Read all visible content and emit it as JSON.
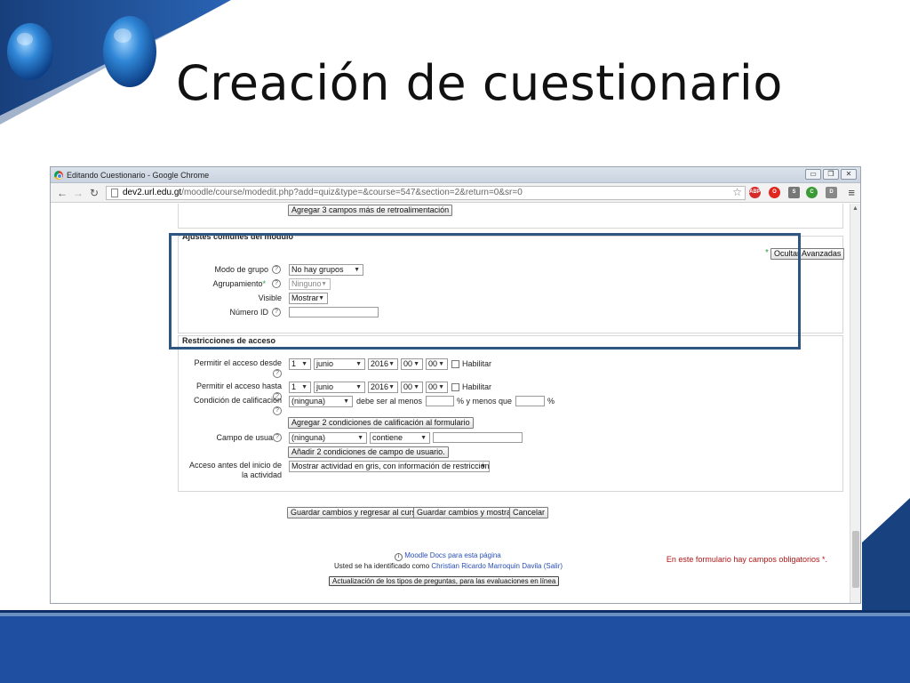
{
  "slide": {
    "title": "Creación de cuestionario"
  },
  "browser": {
    "window_title": "Editando Cuestionario - Google Chrome",
    "url_host": "dev2.url.edu.gt",
    "url_path": "/moodle/course/modedit.php?add=quiz&type=&course=547&section=2&return=0&sr=0",
    "extensions": [
      "ABP",
      "O",
      "S",
      "C",
      "D"
    ]
  },
  "form": {
    "feedback_button": "Agregar 3 campos más de retroalimentación",
    "common_section": {
      "legend": "Ajustes comunes del módulo",
      "advanced_button": "Ocultar Avanzadas",
      "group_mode_label": "Modo de grupo",
      "group_mode_value": "No hay grupos",
      "grouping_label": "Agrupamiento",
      "grouping_value": "Ninguno",
      "visible_label": "Visible",
      "visible_value": "Mostrar",
      "idnumber_label": "Número ID",
      "idnumber_value": ""
    },
    "restrictions": {
      "legend": "Restricciones de acceso",
      "from_label": "Permitir el acceso desde",
      "from_day": "1",
      "from_month": "junio",
      "from_year": "2016",
      "from_hour": "00",
      "from_min": "00",
      "from_enable": "Habilitar",
      "until_label": "Permitir el acceso hasta",
      "until_day": "1",
      "until_month": "junio",
      "until_year": "2016",
      "until_hour": "00",
      "until_min": "00",
      "until_enable": "Habilitar",
      "grade_label": "Condición de calificación",
      "grade_value": "(ninguna)",
      "grade_min_text": "debe ser al menos",
      "grade_pct_and": "% y menos que",
      "grade_pct": "%",
      "grade_add_button": "Agregar 2 condiciones de calificación al formulario",
      "userfield_label": "Campo de usuario",
      "userfield_value": "(ninguna)",
      "userfield_op": "contiene",
      "userfield_add_button": "Añadir 2 condiciones de campo de usuario.",
      "before_label_1": "Acceso antes del inicio de",
      "before_label_2": "la actividad",
      "before_value": "Mostrar actividad en gris, con información de restricción"
    },
    "actions": {
      "save_return": "Guardar cambios y regresar al curso",
      "save_display": "Guardar cambios y mostrar",
      "cancel": "Cancelar"
    },
    "required_note": "En este formulario hay campos obligatorios",
    "required_mark": "*."
  },
  "footer": {
    "docs_link": "Moodle Docs para esta página",
    "logged_in_prefix": "Usted se ha identificado como",
    "user_name": "Christian Ricardo Marroquin Davila",
    "logout": "(Salir)",
    "bottom_button": "Actualización de los tipos de preguntas, para las evaluaciones en línea"
  },
  "colors": {
    "slide_blue": "#1e4fa0",
    "highlight_box": "#2f5680",
    "required_red": "#b01717",
    "link_blue": "#2a4fb5"
  }
}
